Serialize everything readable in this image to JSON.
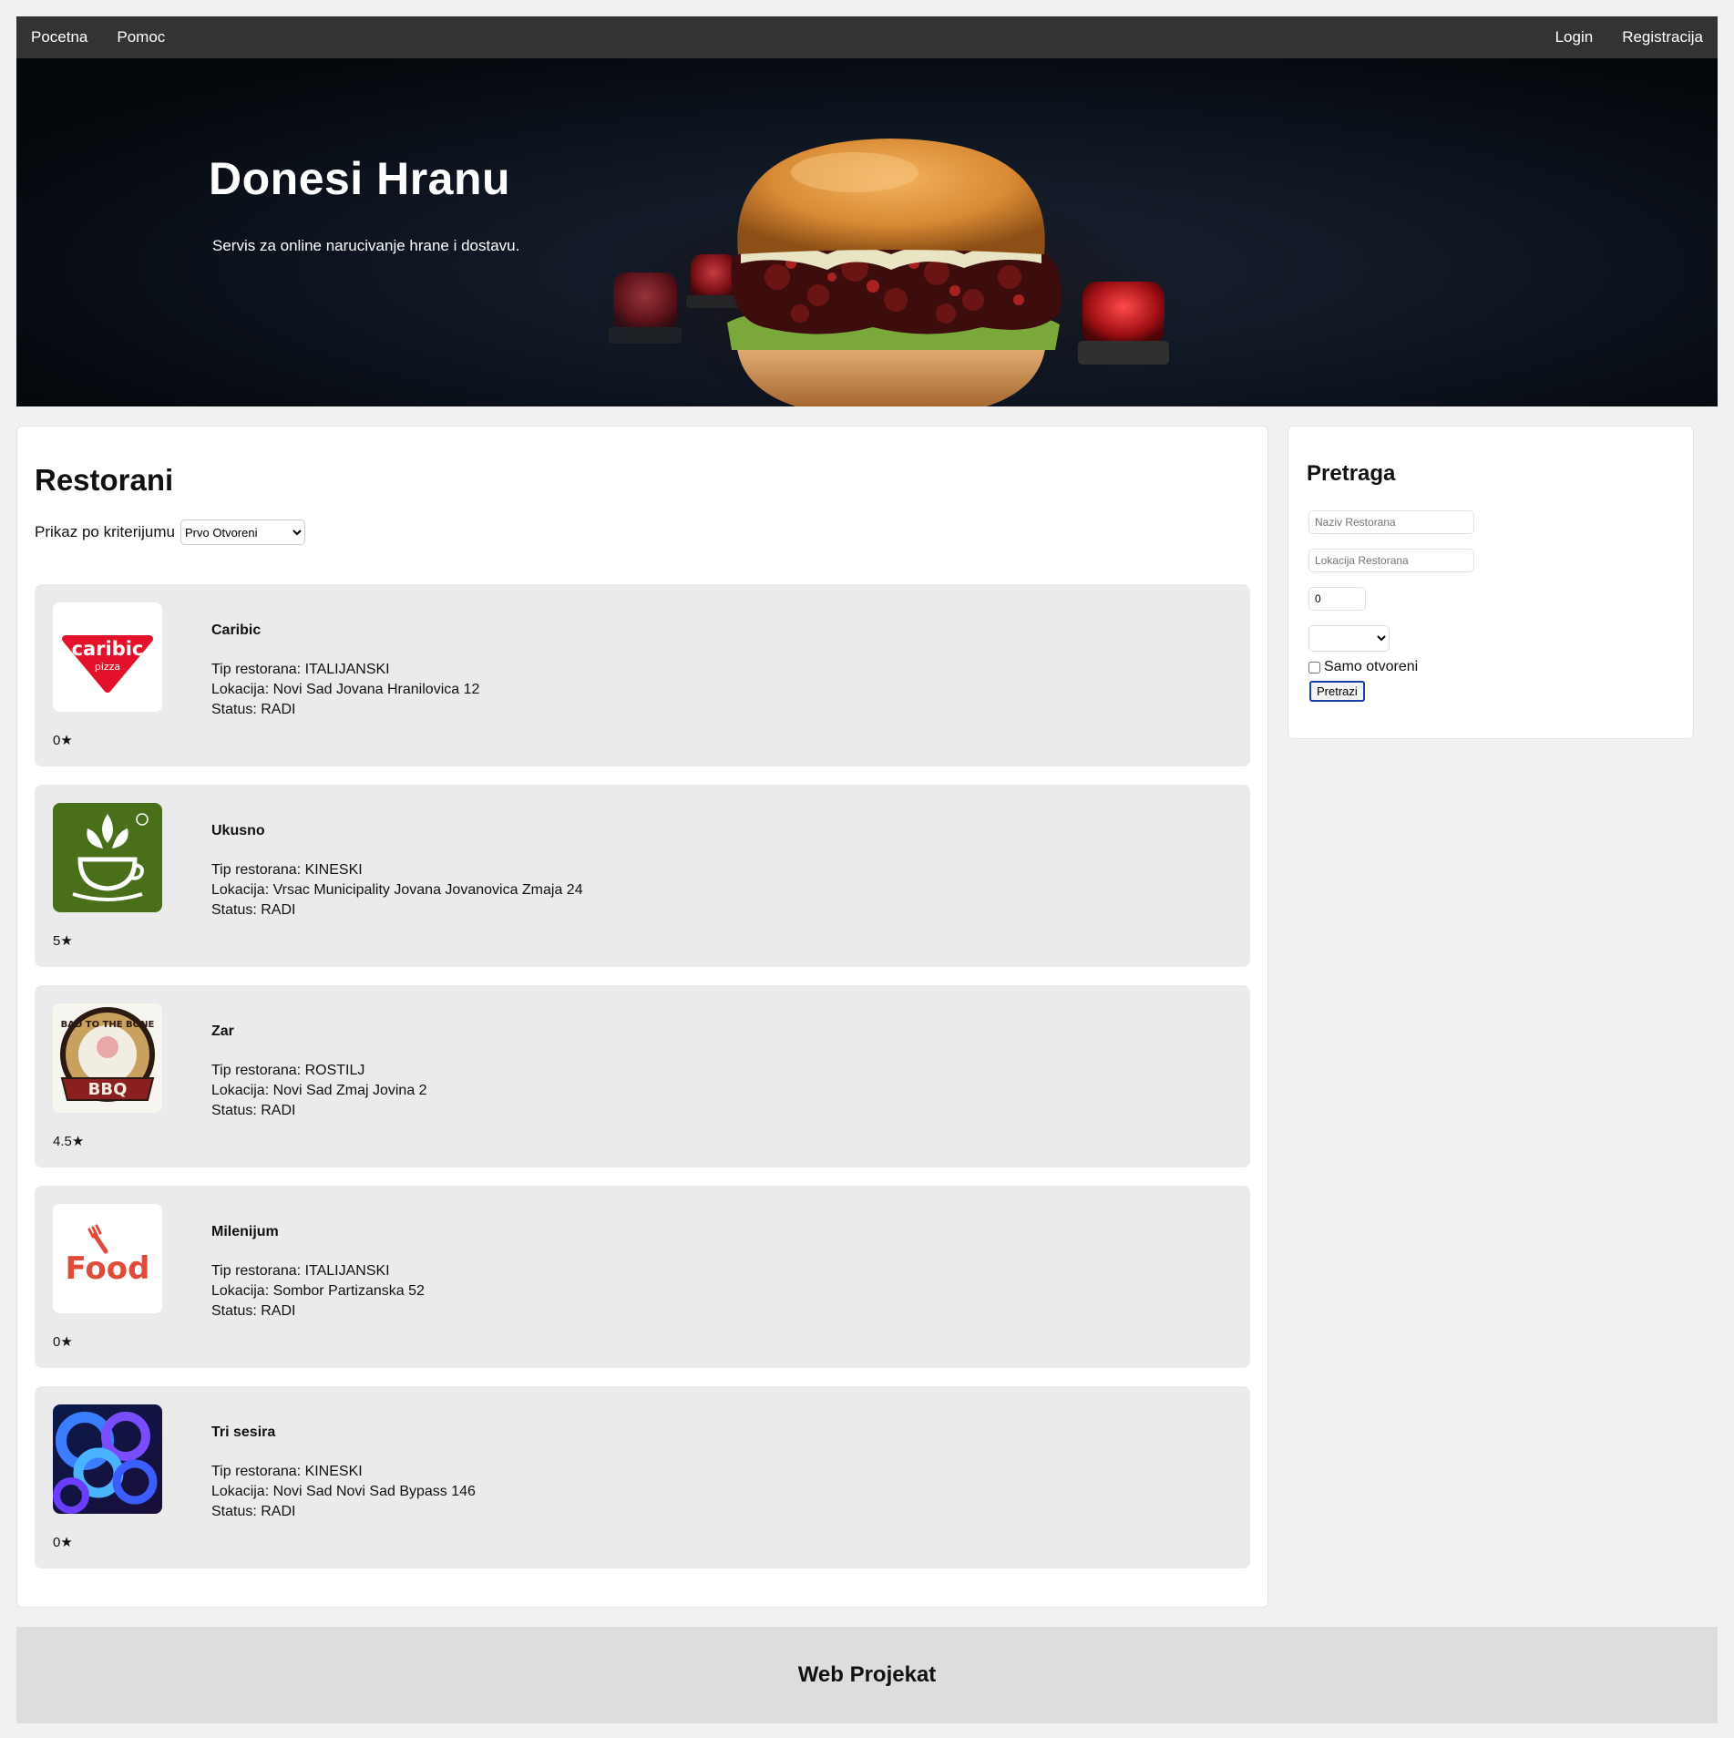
{
  "nav": {
    "left": [
      "Pocetna",
      "Pomoc"
    ],
    "right": [
      "Login",
      "Registracija"
    ]
  },
  "hero": {
    "title": "Donesi Hranu",
    "subtitle": "Servis za online narucivanje hrane i dostavu."
  },
  "restaurants": {
    "title": "Restorani",
    "sort_label": "Prikaz po kriterijumu",
    "sort_selected": "Prvo Otvoreni",
    "items": [
      {
        "name": "Caribic",
        "type": "Tip restorana: ITALIJANSKI",
        "location": "Lokacija: Novi Sad Jovana Hranilovica 12",
        "status": "Status: RADI",
        "rating": "0★",
        "logo": "caribic-pizza-logo",
        "logo_text": [
          "caribic",
          "pizza"
        ]
      },
      {
        "name": "Ukusno",
        "type": "Tip restorana: KINESKI",
        "location": "Lokacija: Vrsac Municipality Jovana Jovanovica Zmaja 24",
        "status": "Status: RADI",
        "rating": "5★",
        "logo": "leaf-cup-logo"
      },
      {
        "name": "Zar",
        "type": "Tip restorana: ROSTILJ",
        "location": "Lokacija: Novi Sad Zmaj Jovina 2",
        "status": "Status: RADI",
        "rating": "4.5★",
        "logo": "bbq-badge-logo",
        "logo_text": [
          "BAD TO THE BONE",
          "BBQ"
        ]
      },
      {
        "name": "Milenijum",
        "type": "Tip restorana: ITALIJANSKI",
        "location": "Lokacija: Sombor Partizanska 52",
        "status": "Status: RADI",
        "rating": "0★",
        "logo": "food-fork-logo",
        "logo_text": [
          "Food"
        ]
      },
      {
        "name": "Tri sesira",
        "type": "Tip restorana: KINESKI",
        "location": "Lokacija: Novi Sad Novi Sad Bypass 146",
        "status": "Status: RADI",
        "rating": "0★",
        "logo": "abstract-blue-logo"
      }
    ]
  },
  "search": {
    "title": "Pretraga",
    "name_placeholder": "Naziv Restorana",
    "location_placeholder": "Lokacija Restorana",
    "rating_value": "0",
    "type_selected": "",
    "open_only_label": "Samo otvoreni",
    "button_label": "Pretrazi"
  },
  "footer": {
    "text": "Web Projekat"
  },
  "colors": {
    "nav_bg": "#333333",
    "card_bg": "#ebebeb",
    "footer_bg": "#dddddd",
    "button_border": "#1a3fa8"
  }
}
